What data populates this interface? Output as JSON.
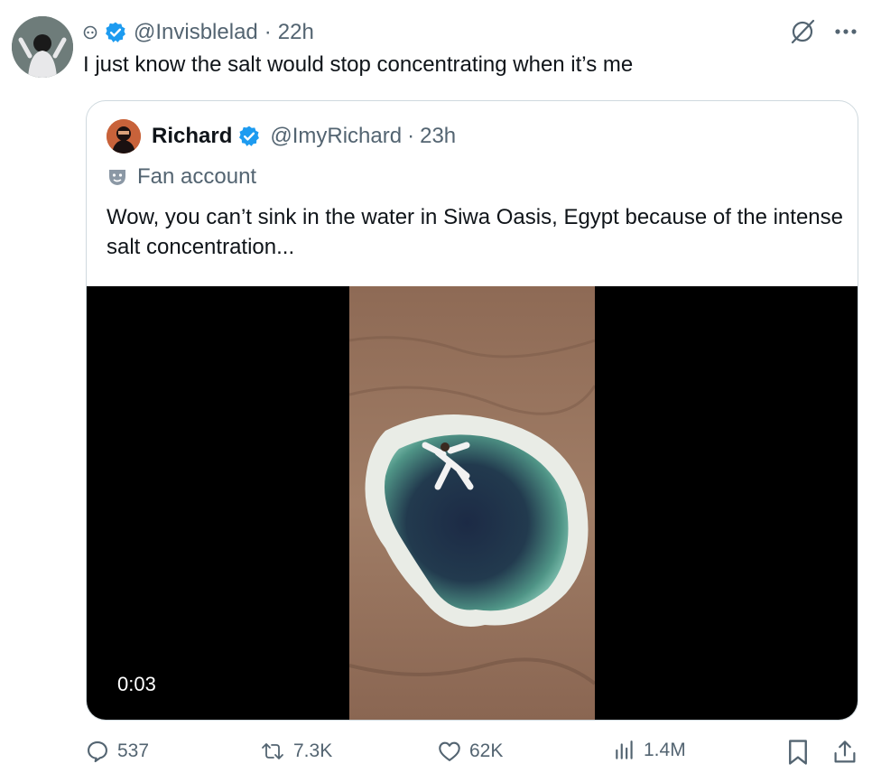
{
  "tweet": {
    "handle": "@Invisblelad",
    "separator": "·",
    "time": "22h",
    "text": "I just know the salt would stop concentrating when it’s me"
  },
  "quote": {
    "name": "Richard",
    "handle": "@ImyRichard",
    "separator": "·",
    "time": "23h",
    "label": "Fan account",
    "text": "Wow, you can’t sink in the water in Siwa Oasis, Egypt because of the intense salt concentration...",
    "video_time": "0:03"
  },
  "actions": {
    "replies": "537",
    "reposts": "7.3K",
    "likes": "62K",
    "views": "1.4M"
  },
  "colors": {
    "verified": "#1d9bf0",
    "muted_text": "#536471",
    "border": "#cfd9de"
  }
}
